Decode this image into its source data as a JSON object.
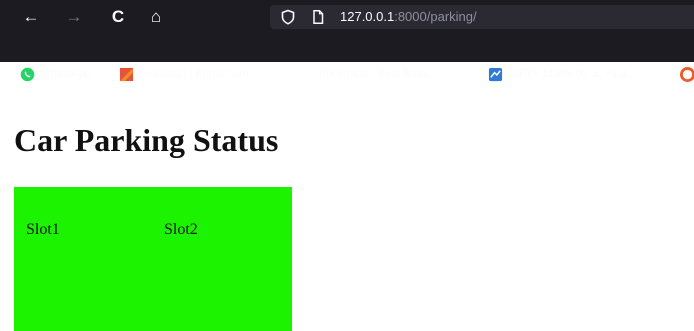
{
  "browser": {
    "nav": {
      "back_icon": "←",
      "forward_icon": "→",
      "reload_icon": "C",
      "home_icon": "⌂"
    },
    "url": {
      "host": "127.0.0.1",
      "rest": ":8000/parking/"
    },
    "bookmarks": [
      {
        "label": "WhatsApp",
        "icon": "whatsapp-icon",
        "color": "#25d366"
      },
      {
        "label": "ProGrad | | Prime num...",
        "icon": "prograd-icon",
        "color": "#e5533d"
      },
      {
        "label": "Tickertape - Best finan...",
        "icon": "tickertape-icon",
        "color": "#ffffff"
      },
      {
        "label": "NIFTY 11395.00 ▲ +1.3...",
        "icon": "nifty-icon",
        "color": "#2e7bd6"
      }
    ]
  },
  "page": {
    "title": "Car Parking Status",
    "lot_color": "#1cf300",
    "slots": [
      {
        "label": "Slot1"
      },
      {
        "label": "Slot2"
      }
    ]
  }
}
